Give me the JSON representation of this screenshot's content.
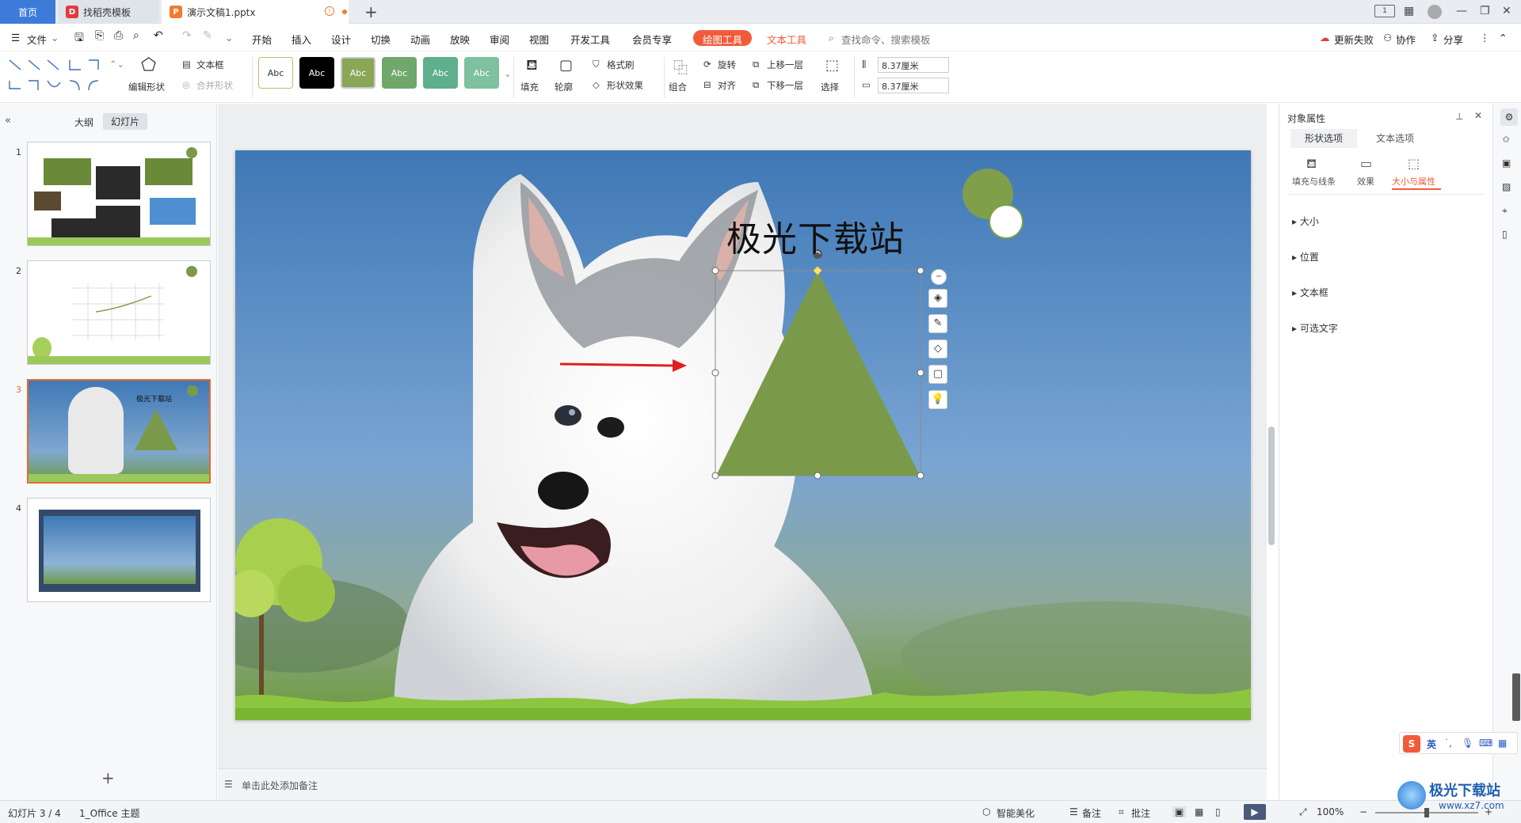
{
  "tabs": {
    "home": "首页",
    "template": "找稻壳模板",
    "document": "演示文稿1.pptx"
  },
  "menu": [
    "文件",
    "开始",
    "插入",
    "设计",
    "切换",
    "动画",
    "放映",
    "审阅",
    "视图",
    "开发工具",
    "会员专享"
  ],
  "menu_active": "绘图工具",
  "menu_text_tool": "文本工具",
  "search_placeholder": "查找命令、搜索模板",
  "menu_right": {
    "update": "更新失败",
    "collab": "协作",
    "share": "分享"
  },
  "ribbon": {
    "edit_shape": "编辑形状",
    "textbox": "文本框",
    "merge_shape": "合并形状",
    "style_label": "Abc",
    "fill": "填充",
    "outline": "轮廓",
    "format_brush": "格式刷",
    "shape_effect": "形状效果",
    "group": "组合",
    "rotate": "旋转",
    "align": "对齐",
    "bring_forward": "上移一层",
    "send_backward": "下移一层",
    "select": "选择",
    "height": "8.37厘米",
    "width": "8.37厘米"
  },
  "left_panel": {
    "outline_tab": "大纲",
    "slides_tab": "幻灯片",
    "slide_numbers": [
      "1",
      "2",
      "3",
      "4"
    ],
    "add_slide": "+"
  },
  "slide": {
    "title": "极光下载站"
  },
  "notes_placeholder": "单击此处添加备注",
  "right_panel": {
    "title": "对象属性",
    "tab_shape": "形状选项",
    "tab_text": "文本选项",
    "sub_fill": "填充与线条",
    "sub_effect": "效果",
    "sub_size": "大小与属性",
    "sections": [
      "大小",
      "位置",
      "文本框",
      "可选文字"
    ]
  },
  "status": {
    "slide_count": "幻灯片 3 / 4",
    "theme": "1_Office 主题",
    "smart": "智能美化",
    "notes": "备注",
    "comment": "批注",
    "zoom": "100%"
  },
  "ime": {
    "lang": "英"
  },
  "watermark": {
    "name": "极光下载站",
    "url": "www.xz7.com"
  },
  "colors": {
    "accent": "#f15b3a",
    "triangle": "#7a9a4a",
    "tab_blue": "#3e7bd9",
    "arrow": "#e02020"
  }
}
